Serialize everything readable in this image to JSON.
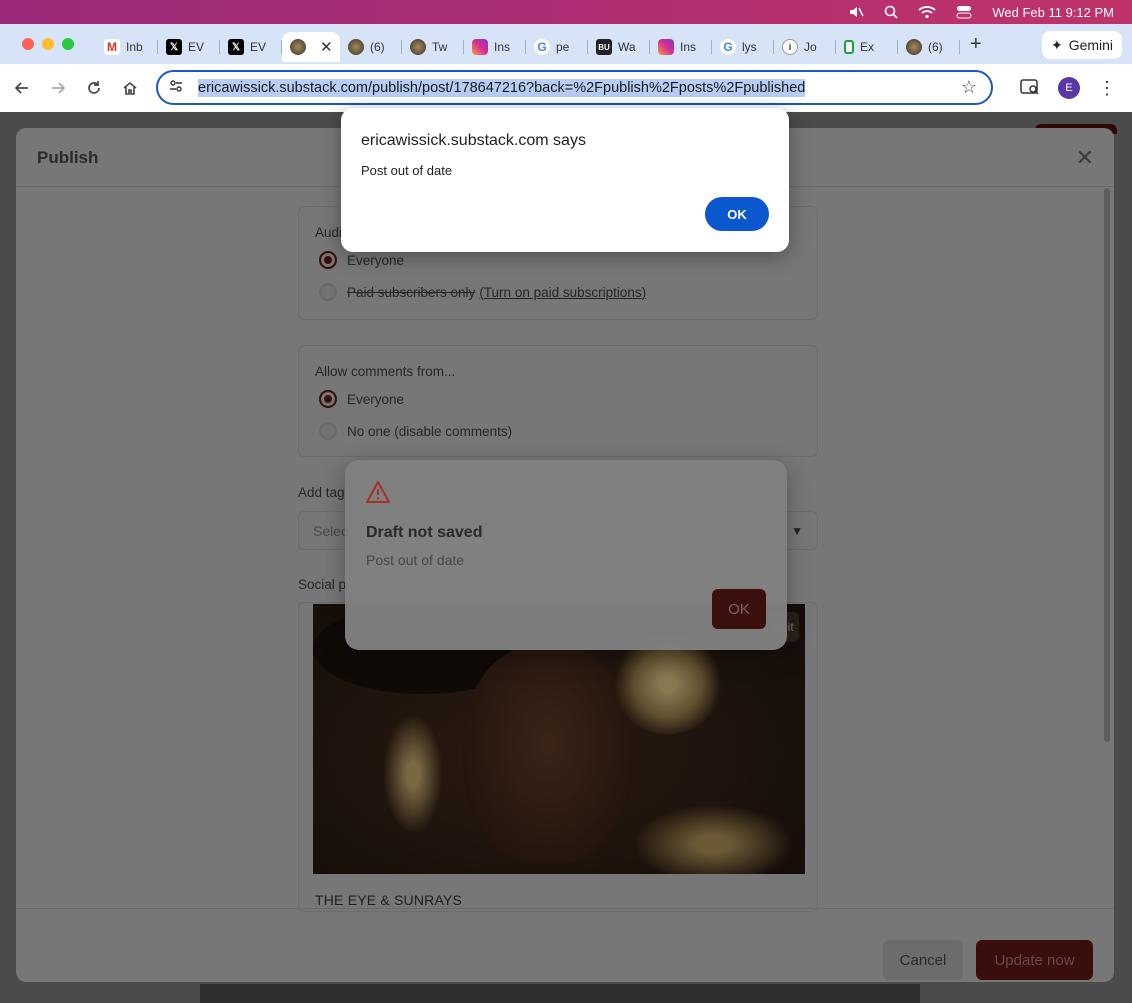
{
  "menubar": {
    "datetime": "Wed Feb 11  9:12 PM"
  },
  "tabs": [
    {
      "label": "Inb",
      "icon": "gmail-icon",
      "fav": "fav-gmail",
      "glyph": "M",
      "active": false
    },
    {
      "label": "EV",
      "icon": "x-icon",
      "fav": "fav-x",
      "glyph": "𝕏",
      "active": false
    },
    {
      "label": "EV",
      "icon": "x-icon",
      "fav": "fav-x",
      "glyph": "𝕏",
      "active": false
    },
    {
      "label": "",
      "icon": "substack-icon",
      "fav": "fav-sub",
      "glyph": "",
      "active": true
    },
    {
      "label": "(6)",
      "icon": "substack-icon",
      "fav": "fav-sub",
      "glyph": "",
      "active": false
    },
    {
      "label": "Tw",
      "icon": "substack-icon",
      "fav": "fav-sub",
      "glyph": "",
      "active": false
    },
    {
      "label": "Ins",
      "icon": "instagram-icon",
      "fav": "fav-ig",
      "glyph": "",
      "active": false
    },
    {
      "label": "pe",
      "icon": "google-icon",
      "fav": "fav-g",
      "glyph": "G",
      "active": false
    },
    {
      "label": "Wa",
      "icon": "bu-icon",
      "fav": "fav-bu",
      "glyph": "BU",
      "active": false
    },
    {
      "label": "Ins",
      "icon": "instagram-icon",
      "fav": "fav-ig",
      "glyph": "",
      "active": false
    },
    {
      "label": "lys",
      "icon": "google-icon",
      "fav": "fav-g",
      "glyph": "G",
      "active": false
    },
    {
      "label": "Jo",
      "icon": "info-icon",
      "fav": "fav-info",
      "glyph": "i",
      "active": false
    },
    {
      "label": "Ex",
      "icon": "extension-icon",
      "fav": "fav-ext",
      "glyph": "",
      "active": false
    },
    {
      "label": "(6)",
      "icon": "substack-icon",
      "fav": "fav-sub",
      "glyph": "",
      "active": false
    }
  ],
  "gemini": {
    "label": "Gemini"
  },
  "omnibox": {
    "url": "ericawissick.substack.com/publish/post/178647216?back=%2Fpublish%2Fposts%2Fpublished"
  },
  "profile": {
    "initial": "E"
  },
  "publish_modal": {
    "title": "Publish",
    "audience": {
      "heading": "Audi",
      "options": [
        {
          "label": "Everyone",
          "selected": true
        },
        {
          "label": "Paid subscribers only",
          "link": "(Turn on paid subscriptions)",
          "selected": false
        }
      ]
    },
    "comments": {
      "heading": "Allow comments from...",
      "options": [
        {
          "label": "Everyone",
          "selected": true
        },
        {
          "label": "No one (disable comments)",
          "selected": false
        }
      ]
    },
    "tags": {
      "label": "Add tag",
      "placeholder": "Selec"
    },
    "social": {
      "label": "Social p",
      "edit_label": "Edit",
      "post_title": "THE EYE & SUNRAYS"
    },
    "cancel_label": "Cancel",
    "update_label": "Update now"
  },
  "draft_dialog": {
    "title": "Draft not saved",
    "message": "Post out of date",
    "ok_label": "OK"
  },
  "browser_alert": {
    "title": "ericawissick.substack.com says",
    "message": "Post out of date",
    "ok_label": "OK"
  },
  "colors": {
    "accent_blue": "#0b57d0",
    "substack_brand": "#3b0f0b"
  }
}
